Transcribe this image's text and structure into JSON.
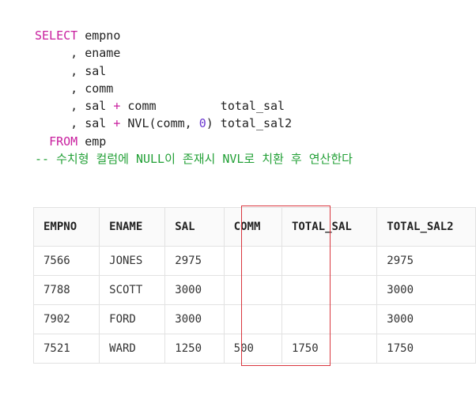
{
  "code": {
    "lines": [
      [
        {
          "t": "SELECT",
          "c": "kw"
        },
        {
          "t": " empno"
        }
      ],
      [
        {
          "t": "     , ename"
        }
      ],
      [
        {
          "t": "     , sal"
        }
      ],
      [
        {
          "t": "     , comm"
        }
      ],
      [
        {
          "t": "     , sal "
        },
        {
          "t": "+",
          "c": "op"
        },
        {
          "t": " comm         total_sal"
        }
      ],
      [
        {
          "t": "     , sal "
        },
        {
          "t": "+",
          "c": "op"
        },
        {
          "t": " NVL(comm, "
        },
        {
          "t": "0",
          "c": "num"
        },
        {
          "t": ") total_sal2"
        }
      ],
      [
        {
          "t": "  "
        },
        {
          "t": "FROM",
          "c": "kw"
        },
        {
          "t": " emp"
        }
      ],
      [
        {
          "t": "-- 수치형 컬럼에 NULL이 존재시 NVL로 치환 후 연산한다",
          "c": "cm"
        }
      ]
    ]
  },
  "table": {
    "columns": [
      "EMPNO",
      "ENAME",
      "SAL",
      "COMM",
      "TOTAL_SAL",
      "TOTAL_SAL2"
    ],
    "rows": [
      [
        "7566",
        "JONES",
        "2975",
        "",
        "",
        "2975"
      ],
      [
        "7788",
        "SCOTT",
        "3000",
        "",
        "",
        "3000"
      ],
      [
        "7902",
        "FORD",
        "3000",
        "",
        "",
        "3000"
      ],
      [
        "7521",
        "WARD",
        "1250",
        "500",
        "1750",
        "1750"
      ]
    ],
    "highlighted_column": "TOTAL_SAL"
  },
  "colors": {
    "keyword": "#c81e9e",
    "number": "#6b38d0",
    "comment": "#22a036",
    "highlight_border": "#d9363e"
  }
}
